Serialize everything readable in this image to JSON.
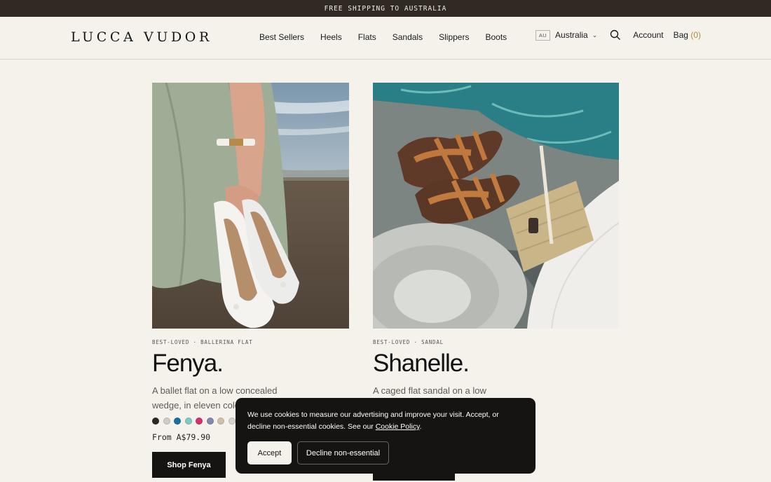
{
  "announcement": "FREE SHIPPING TO AUSTRALIA",
  "brand": "LUCCA VUDOR",
  "nav": [
    "Best Sellers",
    "Heels",
    "Flats",
    "Sandals",
    "Slippers",
    "Boots"
  ],
  "utility": {
    "country_code": "AU",
    "country": "Australia",
    "account": "Account",
    "bag": "Bag",
    "bag_count": "(0)"
  },
  "products": [
    {
      "kicker": "BEST-LOVED · BALLERINA FLAT",
      "name": "Fenya.",
      "description": "A ballet flat on a low concealed wedge, in eleven colo",
      "price": "From A$79.90",
      "button": "Shop Fenya",
      "swatches": [
        "#2b2826",
        "#d0ccc5",
        "#1c6f9c",
        "#7fc9c4",
        "#d0356a",
        "#8389ad",
        "#cfc1a8",
        "#d6d2cc"
      ]
    },
    {
      "kicker": "BEST-LOVED · SANDAL",
      "name": "Shanelle.",
      "description": "A caged flat sandal on a low stacked"
    }
  ],
  "cookie": {
    "text_before": "We use cookies to measure our advertising and improve your visit. Accept, or decline non-essential cookies. See our ",
    "link": "Cookie Policy",
    "text_after": ".",
    "accept": "Accept",
    "decline": "Decline non-essential"
  }
}
